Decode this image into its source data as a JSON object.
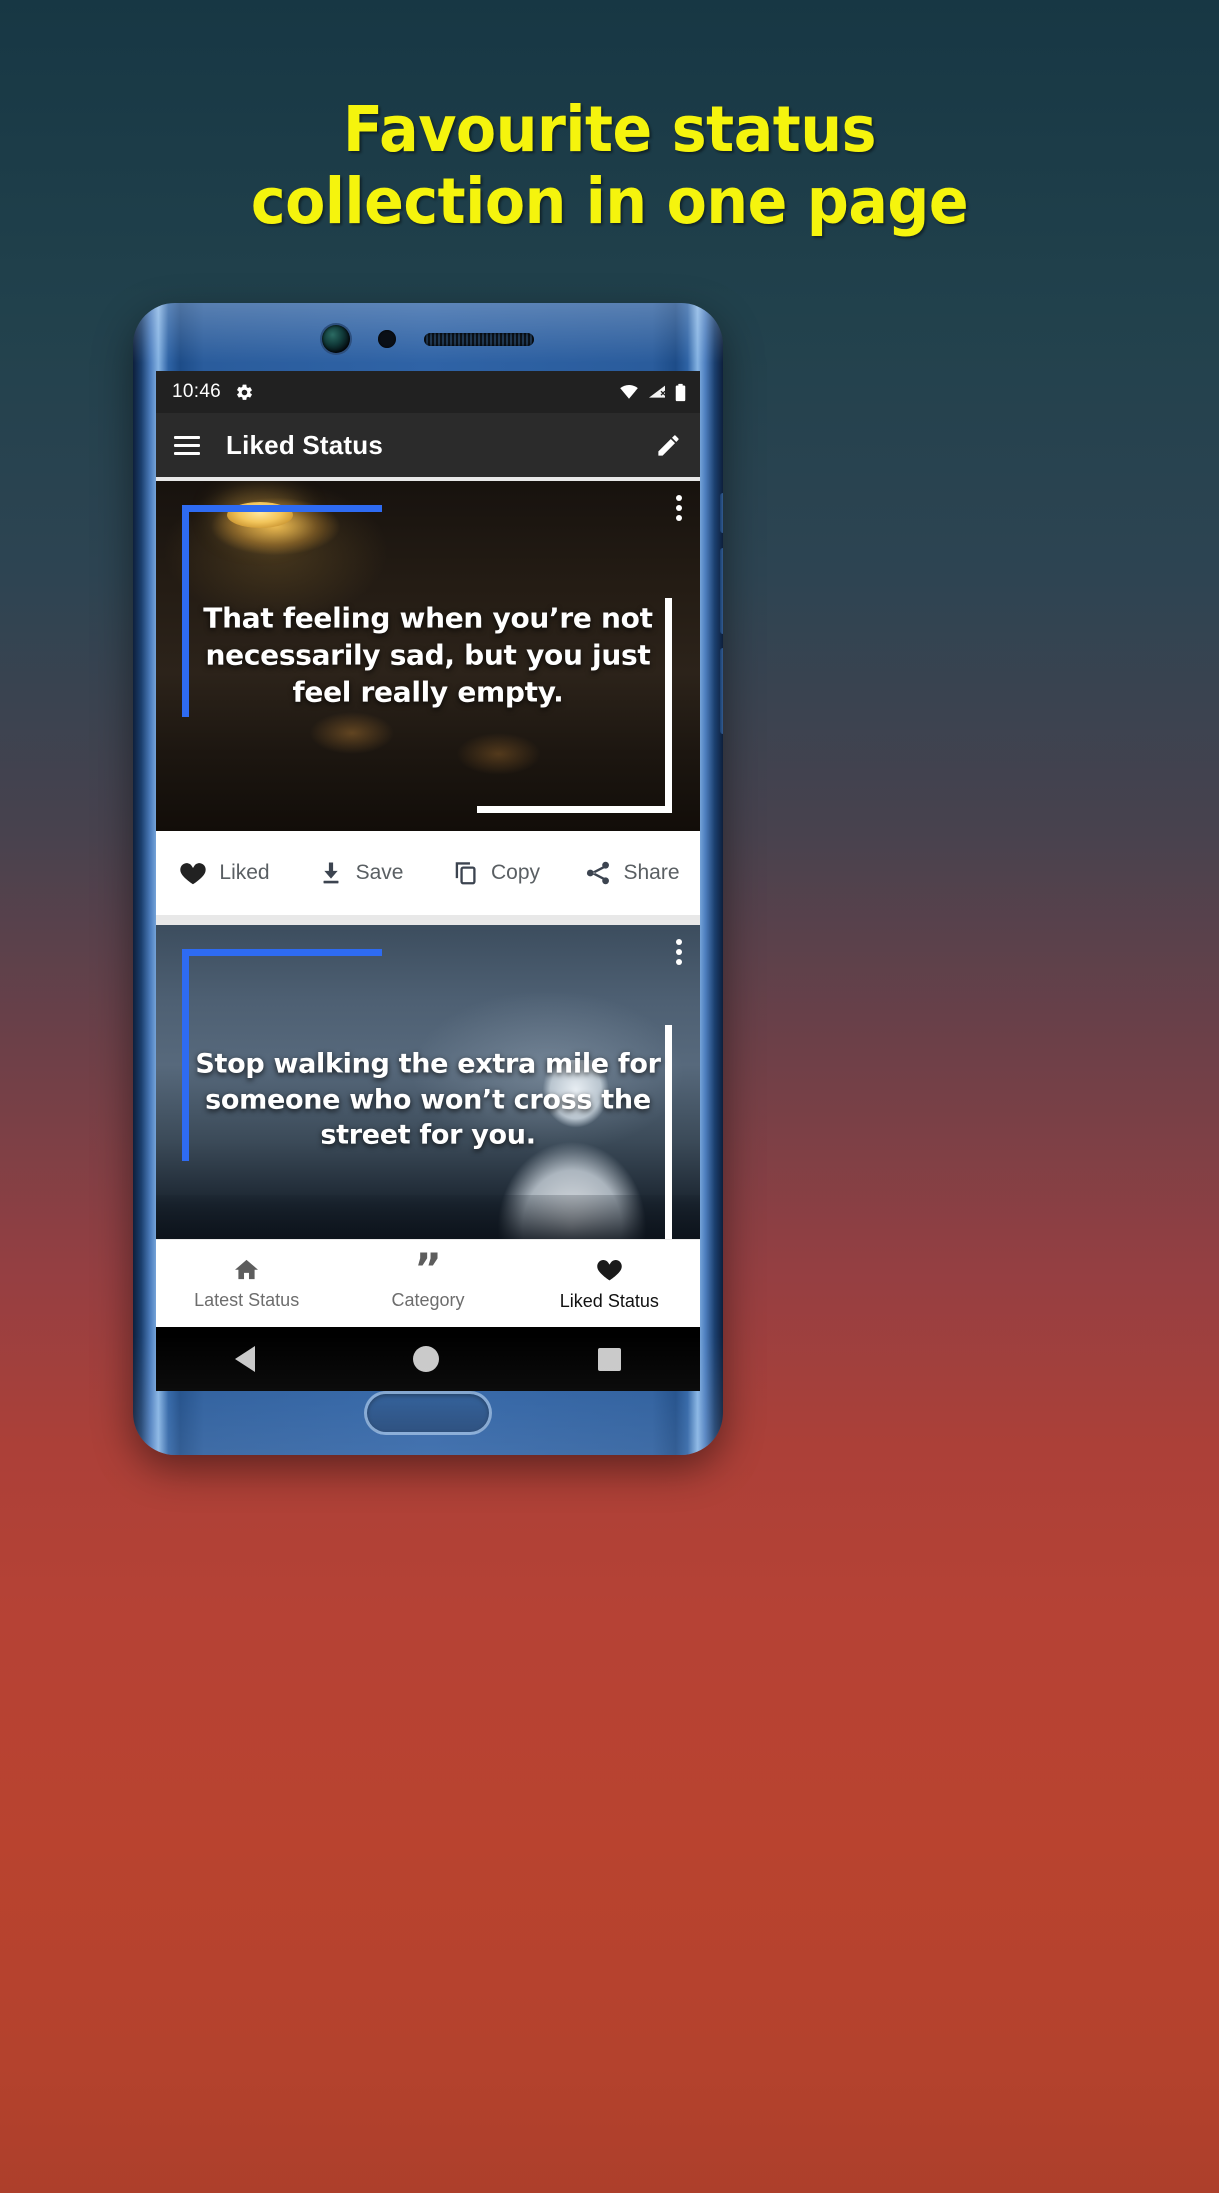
{
  "promo": {
    "headline_line1": "Favourite status",
    "headline_line2": "collection in one page",
    "headline_color": "#f5f40d"
  },
  "device": {
    "statusbar": {
      "time": "10:46",
      "icons": [
        "gear-icon",
        "wifi-icon",
        "signal-icon",
        "battery-icon"
      ]
    },
    "androidnav": {
      "back_label": "Back",
      "home_label": "Home",
      "recents_label": "Recents"
    }
  },
  "appbar": {
    "menu_icon": "hamburger-menu-icon",
    "title": "Liked Status",
    "edit_icon": "pencil-edit-icon"
  },
  "cards": [
    {
      "quote": "That feeling when you’re not necessarily sad, but you just feel really empty.",
      "overflow_icon": "kebab-menu-icon",
      "actions": [
        {
          "label": "Liked",
          "icon": "heart-filled-icon"
        },
        {
          "label": "Save",
          "icon": "download-icon"
        },
        {
          "label": "Copy",
          "icon": "copy-icon"
        },
        {
          "label": "Share",
          "icon": "share-icon"
        }
      ]
    },
    {
      "quote": "Stop walking the extra mile for someone who won’t cross the street for you.",
      "overflow_icon": "kebab-menu-icon"
    }
  ],
  "bottomnav": {
    "items": [
      {
        "label": "Latest Status",
        "icon": "home-icon",
        "active": false
      },
      {
        "label": "Category",
        "icon": "quote-icon",
        "active": false
      },
      {
        "label": "Liked Status",
        "icon": "heart-filled-icon",
        "active": true
      }
    ]
  }
}
